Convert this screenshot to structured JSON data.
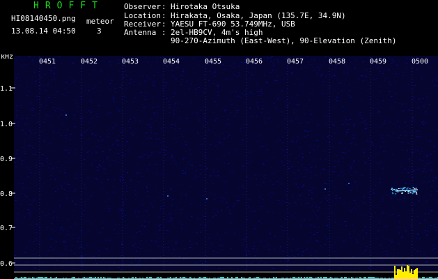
{
  "app": {
    "title": "HROFFT"
  },
  "file": {
    "name": "HI08140450.png",
    "datetime": "13.08.14 04:50",
    "meteor_label": "meteor",
    "meteor_count": "3"
  },
  "station": [
    {
      "key": "Observer",
      "value": "Hirotaka Otsuka"
    },
    {
      "key": "Location",
      "value": "Hirakata, Osaka, Japan (135.7E, 34.9N)"
    },
    {
      "key": "Receiver",
      "value": "YAESU FT-690 53.749MHz, USB"
    },
    {
      "key": "Antenna ",
      "value": "2el-HB9CV, 4m's high"
    },
    {
      "key": "",
      "value": "90-270-Azimuth (East-West), 90-Elevation (Zenith)"
    }
  ],
  "axis": {
    "unit": "kHz",
    "time_ticks": [
      "0451",
      "0452",
      "0453",
      "0454",
      "0455",
      "0456",
      "0457",
      "0458",
      "0459",
      "0500"
    ],
    "freq_ticks": [
      "1.1",
      "1.0",
      "0.9",
      "0.8",
      "0.7",
      "0.6"
    ]
  },
  "colors": {
    "background": "#000000",
    "noise_base": "#0a0a4a",
    "title": "#18e018",
    "signal": "#40ff40",
    "meteor_echo": "#30c0ff",
    "level_bars": "#ffee00"
  }
}
